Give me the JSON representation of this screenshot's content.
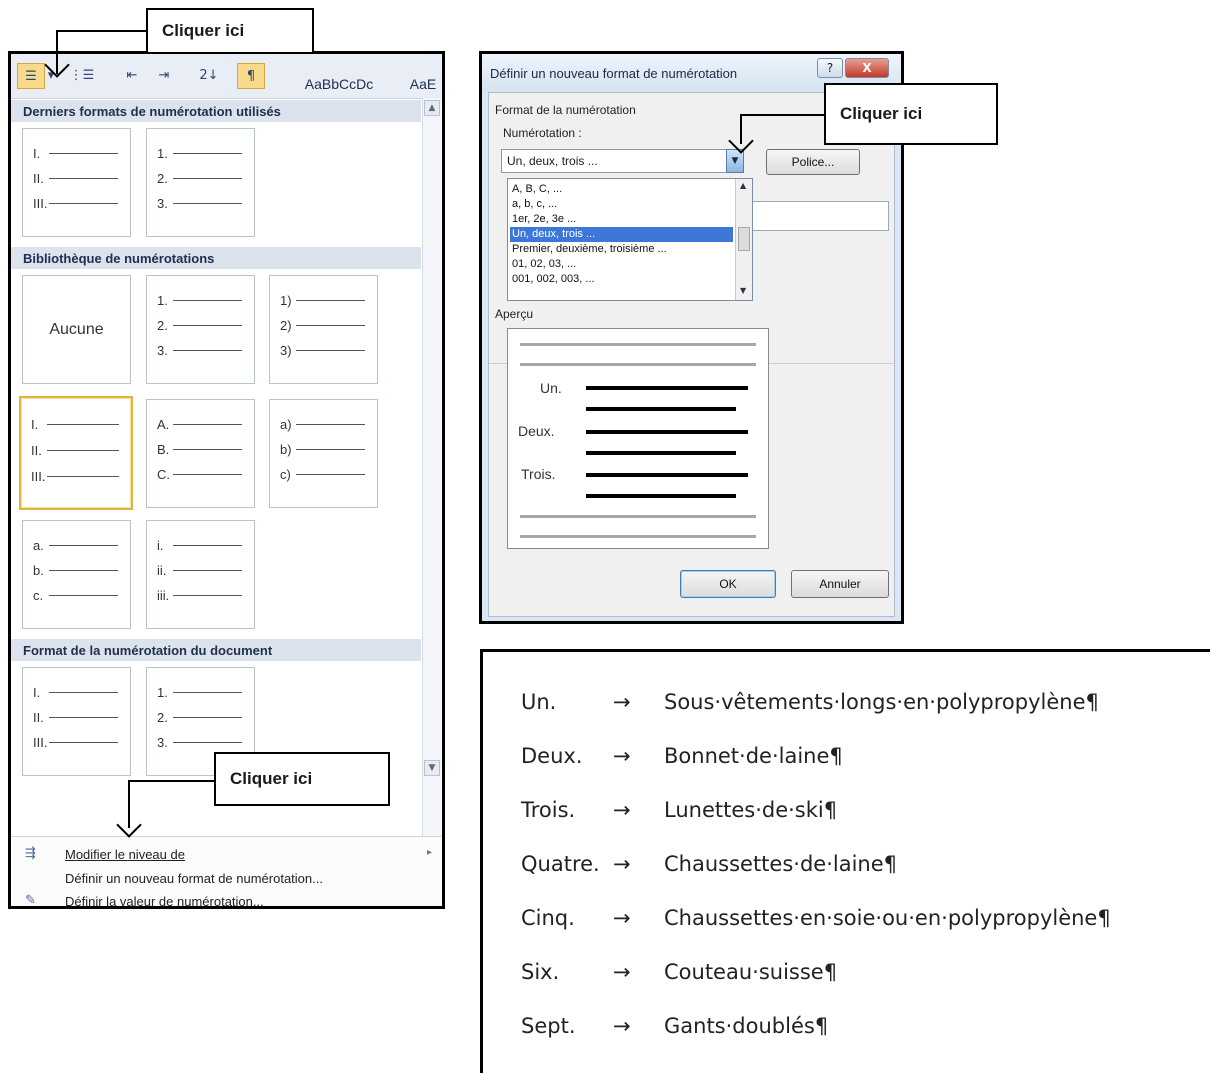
{
  "callouts": {
    "top_left": "Cliquer ici",
    "top_right": "Cliquer ici",
    "bottom_left": "Cliquer ici"
  },
  "gallery": {
    "toolbar": {
      "style_preview_1": "AaBbCcDc",
      "style_preview_2": "AaE"
    },
    "sections": {
      "recent": "Derniers formats de numérotation utilisés",
      "library": "Bibliothèque de numérotations",
      "document": "Format de la numérotation du document"
    },
    "tiles": {
      "recent_1": [
        "I.",
        "II.",
        "III."
      ],
      "recent_2": [
        "1.",
        "2.",
        "3."
      ],
      "none": "Aucune",
      "lib_1": [
        "1.",
        "2.",
        "3."
      ],
      "lib_2": [
        "1)",
        "2)",
        "3)"
      ],
      "lib_3": [
        "I.",
        "II.",
        "III."
      ],
      "lib_4": [
        "A.",
        "B.",
        "C."
      ],
      "lib_5": [
        "a)",
        "b)",
        "c)"
      ],
      "lib_6": [
        "a.",
        "b.",
        "c."
      ],
      "lib_7": [
        "i.",
        "ii.",
        "iii."
      ],
      "doc_1": [
        "I.",
        "II.",
        "III."
      ],
      "doc_2": [
        "1.",
        "2.",
        "3."
      ]
    },
    "menu": {
      "change_level": "Modifier le niveau de",
      "define_new": "Définir un nouveau format de numérotation...",
      "set_value": "Définir la valeur de numérotation..."
    }
  },
  "dialog": {
    "title": "Définir un nouveau format de numérotation",
    "help_button": "?",
    "close_button": "X",
    "group_label": "Format de la numérotation",
    "numbering_label": "Numérotation :",
    "numbering_value": "Un, deux, trois ...",
    "font_button": "Police...",
    "list_items": [
      "A, B, C, ...",
      "a, b, c, ...",
      "1er, 2e, 3e ...",
      "Un, deux, trois ...",
      "Premier, deuxième, troisième ...",
      "01, 02, 03, ...",
      "001, 002, 003, ..."
    ],
    "preview_label": "Aperçu",
    "preview_numbers": [
      "Un.",
      "Deux.",
      "Trois."
    ],
    "ok_button": "OK",
    "cancel_button": "Annuler"
  },
  "result": {
    "tab_mark": "→",
    "items": [
      {
        "num": "Un.",
        "text": "Sous·vêtements·longs·en·polypropylène¶"
      },
      {
        "num": "Deux.",
        "text": "Bonnet·de·laine¶"
      },
      {
        "num": "Trois.",
        "text": "Lunettes·de·ski¶"
      },
      {
        "num": "Quatre.",
        "text": "Chaussettes·de·laine¶"
      },
      {
        "num": "Cinq.",
        "text": "Chaussettes·en·soie·ou·en·polypropylène¶"
      },
      {
        "num": "Six.",
        "text": "Couteau·suisse¶"
      },
      {
        "num": "Sept.",
        "text": "Gants·doublés¶"
      }
    ]
  }
}
